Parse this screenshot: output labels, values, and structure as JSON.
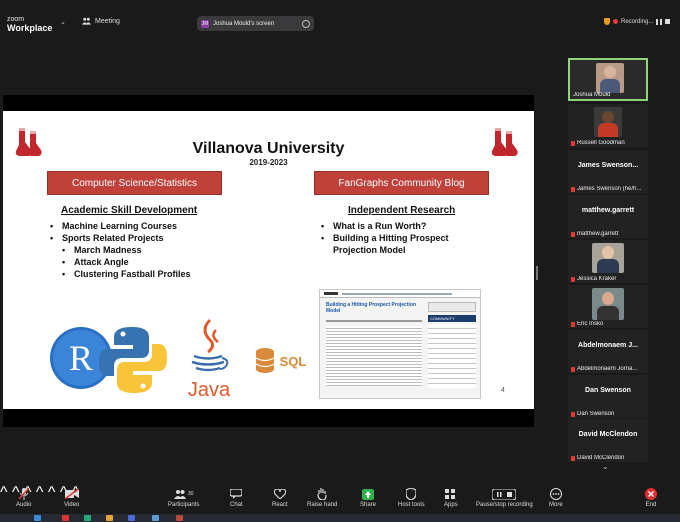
{
  "topbar": {
    "logo_line1": "zoom",
    "logo_line2": "Workplace",
    "meeting_label": "Meeting",
    "share_label": "Joshua Mould's screen",
    "share_avatar": "JM",
    "recording_label": "Recording..."
  },
  "slide": {
    "title": "Villanova University",
    "years": "2019-2023",
    "left_box": "Computer Science/Statistics",
    "right_box": "FanGraphs Community Blog",
    "left_heading": "Academic Skill Development",
    "right_heading": "Independent Research",
    "left_bullets": [
      "Machine Learning Courses",
      "Sports Related Projects"
    ],
    "left_sub_bullets": [
      "March Madness",
      "Attack Angle",
      "Clustering Fastball Profiles"
    ],
    "right_bullets": [
      "What is a Run Worth?",
      "Building a Hitting Prospect"
    ],
    "right_bullet_cont": "Projection Model",
    "blog_title": "Building a Hitting Prospect Projection Model",
    "blog_side_heading": "COMMUNITY",
    "java_text": "Java",
    "sql_text": "SQL",
    "r_text": "R",
    "page_number": "4"
  },
  "gallery": {
    "tiles": [
      {
        "name": "Joshua Mould",
        "type": "video"
      },
      {
        "name": "Russell Goodman",
        "type": "video"
      },
      {
        "big": "James Swenson...",
        "name": "James Swenson (he/h...",
        "type": "name"
      },
      {
        "big": "matthew.garrett",
        "name": "matthew.garrett",
        "type": "name"
      },
      {
        "name": "Jessica Kraker",
        "type": "video"
      },
      {
        "name": "Eric Insko",
        "type": "video"
      },
      {
        "big": "Abdelmonaem J...",
        "name": "Abdelmonaem Jorna...",
        "type": "name"
      },
      {
        "big": "Dan Swenson",
        "name": "Dan Swenson",
        "type": "name"
      },
      {
        "big": "David McClendon",
        "name": "David McClendon",
        "type": "name"
      }
    ]
  },
  "toolbar": {
    "audio": "Audio",
    "video": "Video",
    "participants": "Participants",
    "participants_count": "30",
    "chat": "Chat",
    "react": "React",
    "raise_hand": "Raise hand",
    "share": "Share",
    "host_tools": "Host tools",
    "apps": "Apps",
    "pause_recording": "Pause/stop recording",
    "more": "More",
    "end": "End"
  },
  "colors": {
    "accent_red": "#c0403a",
    "active_border": "#8fd37a",
    "share_green": "#2fb24c",
    "end_red": "#e02f2f"
  }
}
